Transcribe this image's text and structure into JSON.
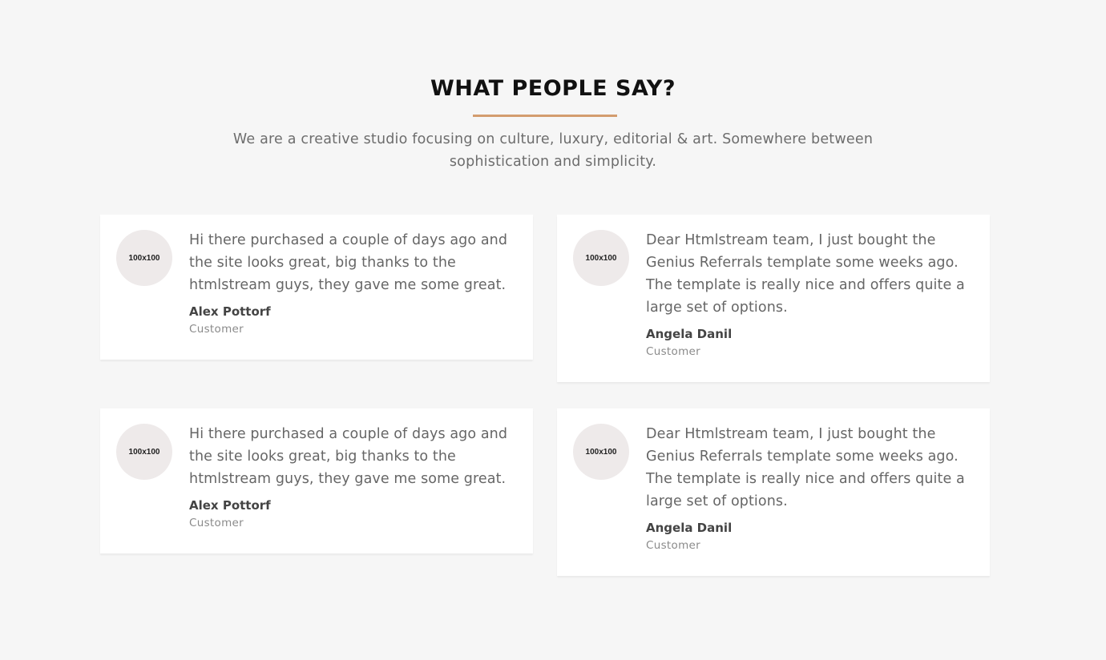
{
  "section": {
    "title": "WHAT PEOPLE SAY?",
    "intro": "We are a creative studio focusing on culture, luxury, editorial & art. Somewhere between sophistication and simplicity.",
    "accent_color": "#d39c6e"
  },
  "testimonials": [
    {
      "avatar_label": "100x100",
      "quote": "Hi there purchased a couple of days ago and the site looks great, big thanks to the htmlstream guys, they gave me some great.",
      "name": "Alex Pottorf",
      "role": "Customer"
    },
    {
      "avatar_label": "100x100",
      "quote": "Dear Htmlstream team, I just bought the Genius Referrals template some weeks ago. The template is really nice and offers quite a large set of options.",
      "name": "Angela Danil",
      "role": "Customer"
    },
    {
      "avatar_label": "100x100",
      "quote": "Hi there purchased a couple of days ago and the site looks great, big thanks to the htmlstream guys, they gave me some great.",
      "name": "Alex Pottorf",
      "role": "Customer"
    },
    {
      "avatar_label": "100x100",
      "quote": "Dear Htmlstream team, I just bought the Genius Referrals template some weeks ago. The template is really nice and offers quite a large set of options.",
      "name": "Angela Danil",
      "role": "Customer"
    }
  ]
}
